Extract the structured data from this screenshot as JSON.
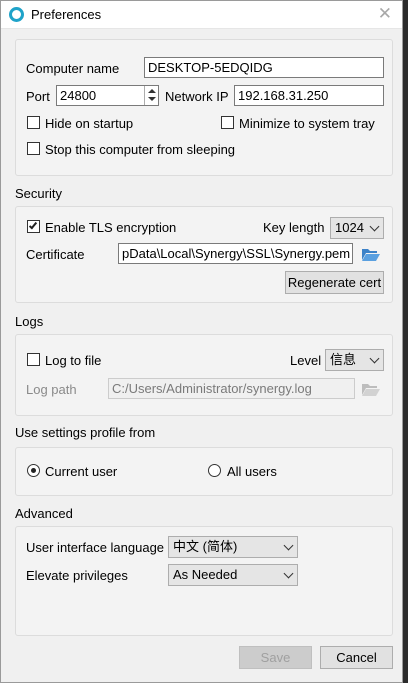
{
  "window": {
    "title": "Preferences",
    "close_glyph": "✕"
  },
  "general": {
    "computer_name_label": "Computer name",
    "computer_name_value": "DESKTOP-5EDQIDG",
    "port_label": "Port",
    "port_value": "24800",
    "network_ip_label": "Network IP",
    "network_ip_value": "192.168.31.250",
    "hide_on_startup": {
      "label": "Hide on startup",
      "checked": false
    },
    "minimize_to_tray": {
      "label": "Minimize to system tray",
      "checked": false
    },
    "stop_sleeping": {
      "label": "Stop this computer from sleeping",
      "checked": false
    }
  },
  "security": {
    "title": "Security",
    "enable_tls": {
      "label": "Enable TLS encryption",
      "checked": true
    },
    "key_length_label": "Key length",
    "key_length_value": "1024",
    "certificate_label": "Certificate",
    "certificate_value": "pData\\Local\\Synergy\\SSL\\Synergy.pem",
    "regenerate_label": "Regenerate cert"
  },
  "logs": {
    "title": "Logs",
    "log_to_file": {
      "label": "Log to file",
      "checked": false
    },
    "level_label": "Level",
    "level_value": "信息",
    "log_path_label": "Log path",
    "log_path_value": "C:/Users/Administrator/synergy.log"
  },
  "profile": {
    "title": "Use settings profile from",
    "current_user": {
      "label": "Current user",
      "selected": true
    },
    "all_users": {
      "label": "All users",
      "selected": false
    }
  },
  "advanced": {
    "title": "Advanced",
    "ui_language_label": "User interface language",
    "ui_language_value": "中文 (简体)",
    "elevate_label": "Elevate privileges",
    "elevate_value": "As Needed"
  },
  "footer": {
    "save_label": "Save",
    "cancel_label": "Cancel"
  },
  "colors": {
    "accent": "#1fa3c9",
    "folder": "#3c82c8"
  }
}
